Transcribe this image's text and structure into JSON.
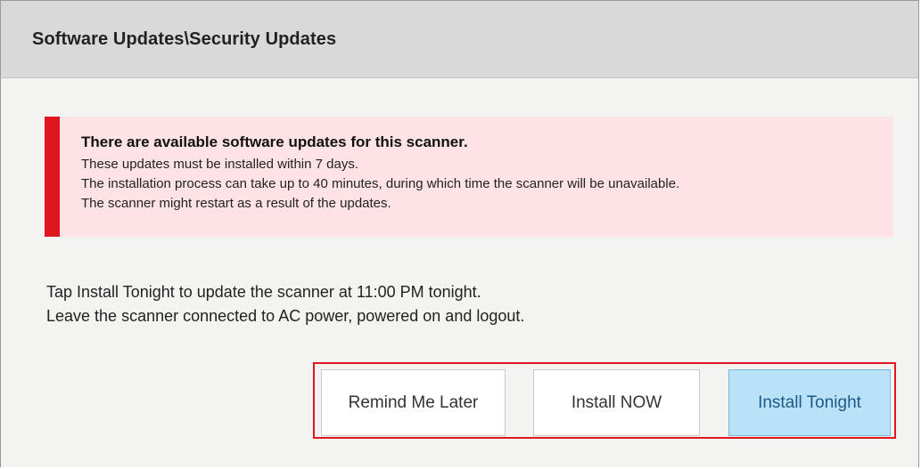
{
  "dialog": {
    "title": "Software Updates\\Security Updates"
  },
  "alert": {
    "heading": "There are available software updates for this scanner.",
    "lines": [
      "These updates must be installed within 7 days.",
      "The installation process can take up to 40 minutes, during which time the scanner will be unavailable.",
      "The scanner might restart as a result of the updates."
    ],
    "accent_color": "#e0161f",
    "background_color": "#fde3e5"
  },
  "instructions": {
    "lines": [
      "Tap Install Tonight to update the scanner at 11:00 PM tonight.",
      "Leave the scanner connected to AC power, powered on and logout."
    ]
  },
  "buttons": {
    "remind_label": "Remind Me Later",
    "install_now_label": "Install NOW",
    "install_tonight_label": "Install Tonight",
    "highlight_color": "#e0161f",
    "primary_color": "#b9e1f7"
  }
}
